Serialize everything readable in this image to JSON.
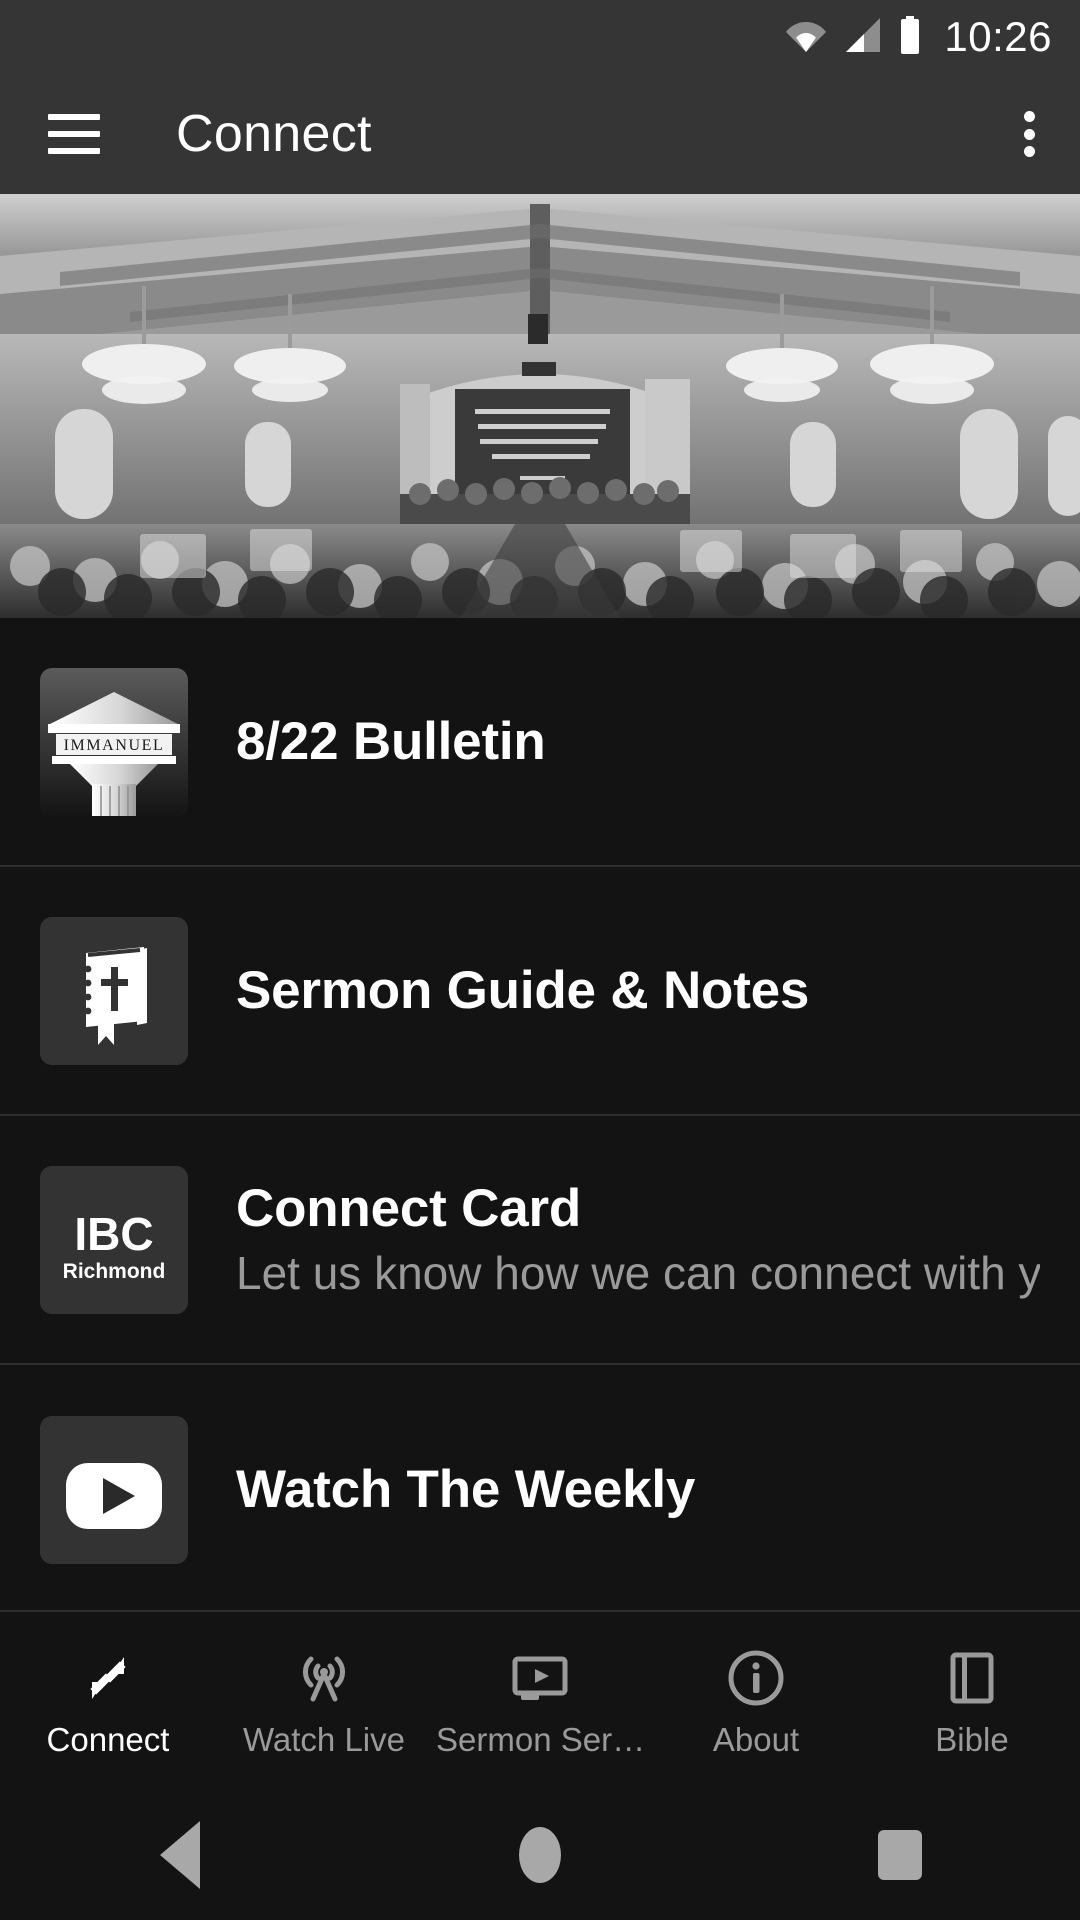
{
  "status_bar": {
    "time": "10:26",
    "icons": [
      "wifi-icon",
      "cell-signal-icon",
      "battery-icon"
    ]
  },
  "app_bar": {
    "menu_icon": "hamburger-menu-icon",
    "title": "Connect",
    "overflow_icon": "more-vert-icon",
    "background": "#353535"
  },
  "hero": {
    "alt": "church-sanctuary-congregation-photo"
  },
  "list": {
    "items": [
      {
        "title": "8/22 Bulletin",
        "subtitle": "",
        "icon": "immanuel-church-logo-icon",
        "tile_label": "IMMANUEL"
      },
      {
        "title": "Sermon Guide & Notes",
        "subtitle": "",
        "icon": "bible-book-icon",
        "tile_label": ""
      },
      {
        "title": "Connect Card",
        "subtitle": "Let us know how we can connect with yo…",
        "icon": "ibc-richmond-logo-icon",
        "tile_label": "IBC",
        "tile_sublabel": "Richmond"
      },
      {
        "title": "Watch The Weekly",
        "subtitle": "",
        "icon": "youtube-play-icon",
        "tile_label": ""
      }
    ]
  },
  "bottom_nav": {
    "items": [
      {
        "label": "Connect",
        "icon": "connect-arrows-icon",
        "active": true
      },
      {
        "label": "Watch Live",
        "icon": "broadcast-antenna-icon",
        "active": false
      },
      {
        "label": "Sermon Ser…",
        "icon": "video-screen-icon",
        "active": false
      },
      {
        "label": "About",
        "icon": "info-circle-icon",
        "active": false
      },
      {
        "label": "Bible",
        "icon": "chrome-reader-icon",
        "active": false
      }
    ],
    "active_color": "#ffffff",
    "inactive_color": "#9a9a9a"
  },
  "system_nav": {
    "back": "back-triangle-icon",
    "home": "home-circle-icon",
    "recents": "recents-square-icon"
  },
  "colors": {
    "app_bar": "#353535",
    "page_background": "#121212",
    "row_background": "#131313",
    "divider": "#2c2e30",
    "tile_background": "#333333",
    "primary_text": "#ffffff",
    "secondary_text": "#9a9a9a"
  }
}
